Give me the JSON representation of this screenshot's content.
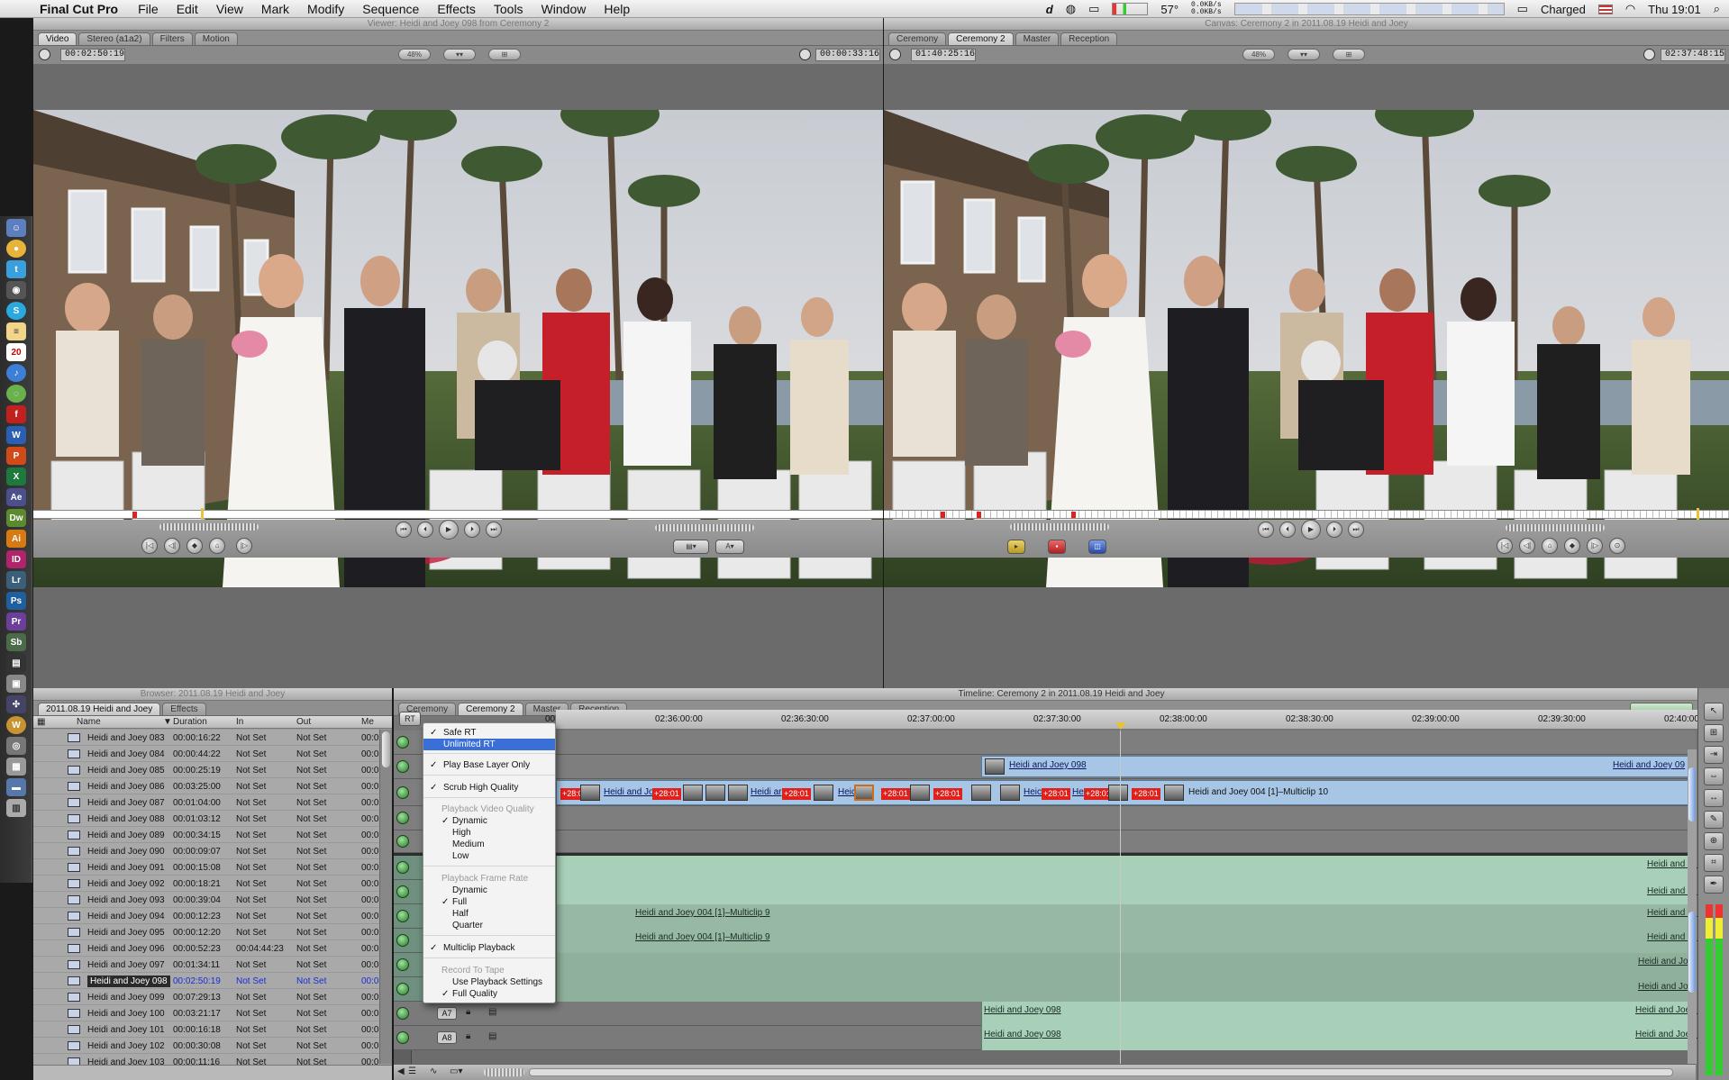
{
  "menubar": {
    "app_name": "Final Cut Pro",
    "items": [
      "File",
      "Edit",
      "View",
      "Mark",
      "Modify",
      "Sequence",
      "Effects",
      "Tools",
      "Window",
      "Help"
    ],
    "temperature": "57°",
    "net_up": "0.0KB/s",
    "net_down": "0.0KB/s",
    "battery": "Charged",
    "clock": "Thu 19:01"
  },
  "dock": {
    "icons": [
      "finder-icon",
      "chrome-icon",
      "twitter-icon",
      "camera-icon",
      "skype-icon",
      "notes-icon",
      "calendar-icon",
      "itunes-icon",
      "spotify-icon",
      "flash-icon",
      "word-icon",
      "powerpoint-icon",
      "excel-icon",
      "after-effects-icon",
      "dreamweaver-icon",
      "illustrator-icon",
      "indesign-icon",
      "lightroom-icon",
      "photoshop-icon",
      "premiere-icon",
      "soundbooth-icon",
      "clapper-icon",
      "photos-icon",
      "app-icon",
      "wordpress-icon",
      "screenshot-icon",
      "final-cut-icon",
      "folder-icon",
      "trash-icon"
    ],
    "calendar_day": "20"
  },
  "viewer": {
    "title": "Viewer: Heidi and Joey  098 from Ceremony 2",
    "tabs": [
      "Video",
      "Stereo (a1a2)",
      "Filters",
      "Motion"
    ],
    "active_tab": "Video",
    "timecode_left": "00:02:50:19",
    "zoom": "48%",
    "timecode_right": "00:00:33:16"
  },
  "canvas": {
    "title": "Canvas: Ceremony 2 in 2011.08.19 Heidi and Joey",
    "tabs": [
      "Ceremony",
      "Ceremony 2",
      "Master",
      "Reception"
    ],
    "active_tab": "Ceremony 2",
    "timecode_left": "01:40:25:16",
    "zoom": "48%",
    "timecode_right": "02:37:48:15"
  },
  "browser": {
    "title": "Browser: 2011.08.19 Heidi and Joey",
    "tabs": [
      "2011.08.19 Heidi and Joey",
      "Effects"
    ],
    "columns": [
      "Name",
      "Duration",
      "In",
      "Out",
      "Me"
    ],
    "rows": [
      {
        "name": "Heidi and Joey  083",
        "duration": "00:00:16:22",
        "in": "Not Set",
        "out": "Not Set",
        "media": "00:0"
      },
      {
        "name": "Heidi and Joey  084",
        "duration": "00:00:44:22",
        "in": "Not Set",
        "out": "Not Set",
        "media": "00:0"
      },
      {
        "name": "Heidi and Joey  085",
        "duration": "00:00:25:19",
        "in": "Not Set",
        "out": "Not Set",
        "media": "00:0"
      },
      {
        "name": "Heidi and Joey  086",
        "duration": "00:03:25:00",
        "in": "Not Set",
        "out": "Not Set",
        "media": "00:0"
      },
      {
        "name": "Heidi and Joey  087",
        "duration": "00:01:04:00",
        "in": "Not Set",
        "out": "Not Set",
        "media": "00:0"
      },
      {
        "name": "Heidi and Joey  088",
        "duration": "00:01:03:12",
        "in": "Not Set",
        "out": "Not Set",
        "media": "00:0"
      },
      {
        "name": "Heidi and Joey  089",
        "duration": "00:00:34:15",
        "in": "Not Set",
        "out": "Not Set",
        "media": "00:0"
      },
      {
        "name": "Heidi and Joey  090",
        "duration": "00:00:09:07",
        "in": "Not Set",
        "out": "Not Set",
        "media": "00:0"
      },
      {
        "name": "Heidi and Joey  091",
        "duration": "00:00:15:08",
        "in": "Not Set",
        "out": "Not Set",
        "media": "00:0"
      },
      {
        "name": "Heidi and Joey  092",
        "duration": "00:00:18:21",
        "in": "Not Set",
        "out": "Not Set",
        "media": "00:0"
      },
      {
        "name": "Heidi and Joey  093",
        "duration": "00:00:39:04",
        "in": "Not Set",
        "out": "Not Set",
        "media": "00:0"
      },
      {
        "name": "Heidi and Joey  094",
        "duration": "00:00:12:23",
        "in": "Not Set",
        "out": "Not Set",
        "media": "00:0"
      },
      {
        "name": "Heidi and Joey  095",
        "duration": "00:00:12:20",
        "in": "Not Set",
        "out": "Not Set",
        "media": "00:0"
      },
      {
        "name": "Heidi and Joey  096",
        "duration": "00:00:52:23",
        "in": "00:04:44:23",
        "out": "Not Set",
        "media": "00:0"
      },
      {
        "name": "Heidi and Joey  097",
        "duration": "00:01:34:11",
        "in": "Not Set",
        "out": "Not Set",
        "media": "00:0"
      },
      {
        "name": "Heidi and Joey  098",
        "duration": "00:02:50:19",
        "in": "Not Set",
        "out": "Not Set",
        "media": "00:0",
        "selected": true
      },
      {
        "name": "Heidi and Joey  099",
        "duration": "00:07:29:13",
        "in": "Not Set",
        "out": "Not Set",
        "media": "00:0"
      },
      {
        "name": "Heidi and Joey  100",
        "duration": "00:03:21:17",
        "in": "Not Set",
        "out": "Not Set",
        "media": "00:0"
      },
      {
        "name": "Heidi and Joey  101",
        "duration": "00:00:16:18",
        "in": "Not Set",
        "out": "Not Set",
        "media": "00:0"
      },
      {
        "name": "Heidi and Joey  102",
        "duration": "00:00:30:08",
        "in": "Not Set",
        "out": "Not Set",
        "media": "00:0"
      },
      {
        "name": "Heidi and Joey  103",
        "duration": "00:00:11:16",
        "in": "Not Set",
        "out": "Not Set",
        "media": "00:0"
      }
    ]
  },
  "timeline": {
    "title": "Timeline: Ceremony 2 in 2011.08.19 Heidi and Joey",
    "tabs": [
      "Ceremony",
      "Ceremony 2",
      "Master",
      "Reception"
    ],
    "active_tab": "Ceremony 2",
    "rt_button": "RT",
    "ruler_times": [
      "00",
      "02:36:00:00",
      "02:36:30:00",
      "02:37:00:00",
      "02:37:30:00",
      "02:38:00:00",
      "02:38:30:00",
      "02:39:00:00",
      "02:39:30:00",
      "02:40:00"
    ],
    "v2_clip_label": "Heidi and Joey  098",
    "v2_clip_label_right": "Heidi and Joey  09",
    "v1_clip_labels": [
      "Heidi and Joey",
      "Heidi ar",
      "Heic",
      "Heic",
      "He",
      "Heidi and Joey  004 [1]–Multiclip 10"
    ],
    "red_tag": "+28:01",
    "audio_multiclip_label": "Heidi and Joey  004 [1]–Multiclip 9",
    "audio_right_label": "Heidi and Joe",
    "a7_label": "A7",
    "a8_label": "A8",
    "audio_clip_098": "Heidi and Joey  098",
    "audio_clip_098_right": "Heidi and Joey  09"
  },
  "rt_menu": {
    "safe_rt": "Safe RT",
    "unlimited_rt": "Unlimited RT",
    "play_base_layer": "Play Base Layer Only",
    "scrub_high_quality": "Scrub High Quality",
    "video_quality_header": "Playback Video Quality",
    "video_quality_options": [
      "Dynamic",
      "High",
      "Medium",
      "Low"
    ],
    "frame_rate_header": "Playback Frame Rate",
    "frame_rate_options": [
      "Dynamic",
      "Full",
      "Half",
      "Quarter"
    ],
    "multiclip_playback": "Multiclip Playback",
    "record_header": "Record To Tape",
    "use_playback_settings": "Use Playback Settings",
    "full_quality": "Full Quality",
    "check": "✓"
  }
}
